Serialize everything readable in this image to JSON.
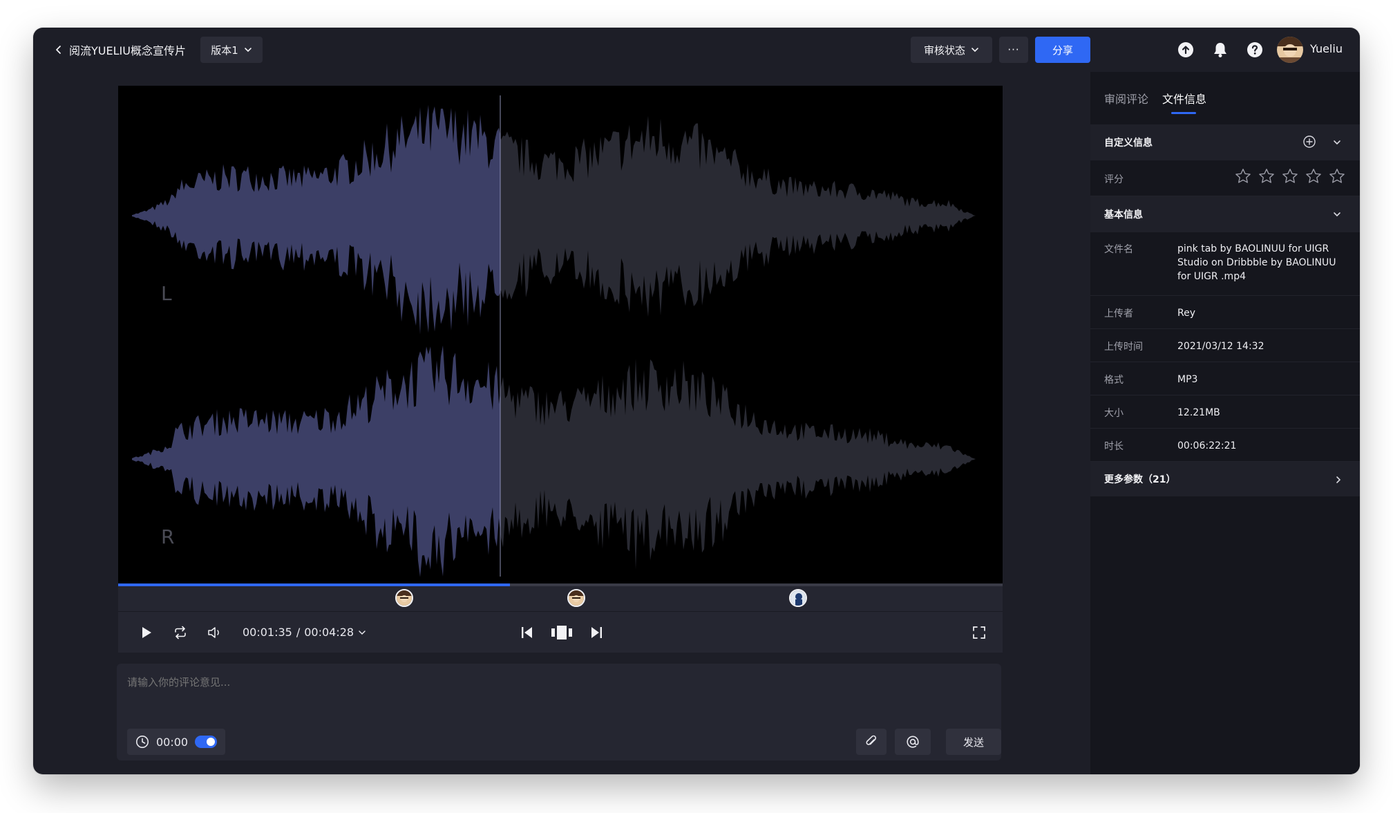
{
  "header": {
    "project_title": "阅流YUELIU概念宣传片",
    "version_label": "版本1",
    "review_status_label": "审核状态",
    "more_label": "···",
    "share_label": "分享",
    "user_name": "Yueliu"
  },
  "player": {
    "left_channel_label": "L",
    "right_channel_label": "R",
    "current_time": "00:01:35",
    "time_separator": "/",
    "total_time": "00:04:28",
    "progress": 0.443
  },
  "comment": {
    "placeholder": "请输入你的评论意见...",
    "timestamp": "00:00",
    "send_label": "发送"
  },
  "panel": {
    "tabs": [
      {
        "label": "审阅评论",
        "active": false
      },
      {
        "label": "文件信息",
        "active": true
      }
    ],
    "custom_section_title": "自定义信息",
    "rating_label": "评分",
    "rating_value": 0,
    "rating_max": 5,
    "basic_section_title": "基本信息",
    "rows": [
      {
        "key": "文件名",
        "value": "pink tab by BAOLINUU for UIGR Studio on Dribbble by BAOLINUU for UIGR .mp4"
      },
      {
        "key": "上传者",
        "value": "Rey"
      },
      {
        "key": "上传时间",
        "value": "2021/03/12 14:32"
      },
      {
        "key": "格式",
        "value": "MP3"
      },
      {
        "key": "大小",
        "value": "12.21MB"
      },
      {
        "key": "时长",
        "value": "00:06:22:21"
      }
    ],
    "more_params_label": "更多参数（21）"
  },
  "colors": {
    "accent": "#2f68f4",
    "waveform_played": "#3c3f66",
    "waveform_unplayed": "#292a33",
    "app_background": "#1d1e27"
  }
}
